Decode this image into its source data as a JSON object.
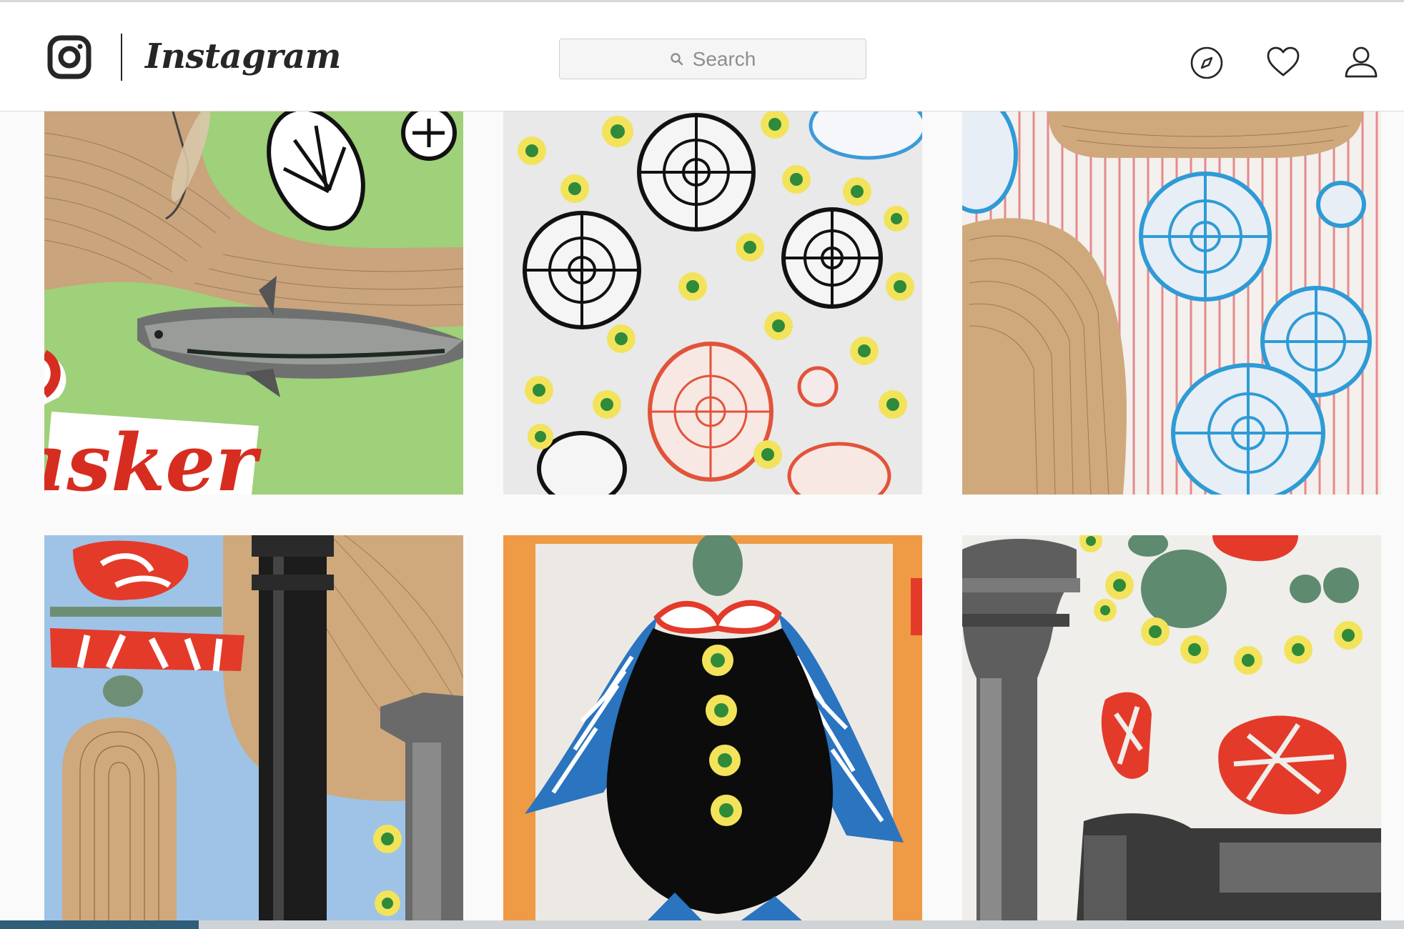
{
  "app": {
    "name": "Instagram"
  },
  "header": {
    "wordmark": "Instagram",
    "search": {
      "placeholder": "Search"
    },
    "nav_icons": [
      "explore-compass-icon",
      "activity-heart-icon",
      "profile-person-icon"
    ],
    "notification_dot": true
  },
  "colors": {
    "text": "#262626",
    "border": "#dbdbdb",
    "background": "#fafafa",
    "notification": "#ed4956"
  },
  "grid": {
    "columns": 3,
    "posts": [
      {
        "subject": "collage with mackerel fish, dragonfly, shells and red lettering on green"
      },
      {
        "subject": "black and red spiral shells with yellow flower dots on white"
      },
      {
        "subject": "blue spiral shells on red striped paper with wood-grain shape"
      },
      {
        "subject": "red cutouts, wood-grain shape and black lamp post on blue"
      },
      {
        "subject": "figure with blue patterned cape, black body and flower buttons"
      },
      {
        "subject": "grey columns, green circles, red cutouts and flower dots"
      }
    ],
    "fish_label_text": "asker"
  }
}
